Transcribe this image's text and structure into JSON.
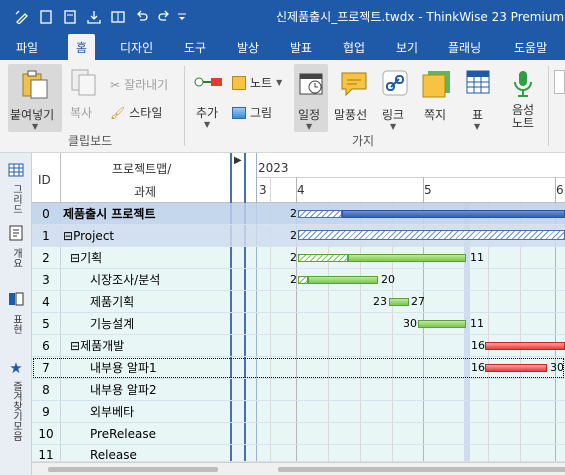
{
  "window": {
    "title": "신제품출시_프로젝트.twdx  -  ThinkWise 23 Premium",
    "brand_color": "#1e5aa8"
  },
  "quick_access": [
    "pen-icon",
    "new-doc-icon",
    "open-doc-icon",
    "save-icon",
    "book-icon",
    "undo-icon",
    "redo-icon",
    "customize-icon"
  ],
  "menus": [
    {
      "label": "파일",
      "active": false
    },
    {
      "label": "홈",
      "active": true
    },
    {
      "label": "디자인",
      "active": false
    },
    {
      "label": "도구",
      "active": false
    },
    {
      "label": "발상",
      "active": false
    },
    {
      "label": "발표",
      "active": false
    },
    {
      "label": "협업",
      "active": false
    },
    {
      "label": "보기",
      "active": false
    },
    {
      "label": "플래닝",
      "active": false
    },
    {
      "label": "도움말",
      "active": false
    }
  ],
  "ribbon": {
    "clipboard": {
      "paste": "붙여넣기",
      "copy": "복사",
      "cut": "잘라내기",
      "style": "스타일",
      "group": "클립보드"
    },
    "branch": {
      "add": "추가",
      "note": "노트",
      "picture": "그림",
      "schedule": "일정",
      "callout": "말풍선",
      "link": "링크",
      "memo": "쪽지",
      "table": "표",
      "voice_note": "음성 노트",
      "group": "가지"
    }
  },
  "side_panel": [
    {
      "icon": "grid-view-icon",
      "label": "그리드"
    },
    {
      "icon": "document-icon",
      "label": "개요"
    },
    {
      "icon": "outline-icon",
      "label": "표현"
    },
    {
      "icon": "star-icon",
      "label": "즐겨찾기모음"
    }
  ],
  "gantt": {
    "headers": {
      "id": "ID",
      "task_line1": "프로젝트맵/",
      "task_line2": "과제",
      "year": "2023"
    },
    "months": [
      "3",
      "4",
      "5",
      "6"
    ],
    "rows": [
      {
        "id": "0",
        "task": "제품출시 프로젝트",
        "indent": 0,
        "toggle": "",
        "bold": true,
        "start_label": "2",
        "end_label": ""
      },
      {
        "id": "1",
        "task": "Project",
        "indent": 0,
        "toggle": "⊟",
        "bold": false,
        "start_label": "2",
        "end_label": ""
      },
      {
        "id": "2",
        "task": "기획",
        "indent": 1,
        "toggle": "⊟",
        "bold": false,
        "start_label": "2",
        "end_label": "11"
      },
      {
        "id": "3",
        "task": "시장조사/분석",
        "indent": 2,
        "toggle": "",
        "bold": false,
        "start_label": "2",
        "end_label": "20"
      },
      {
        "id": "4",
        "task": "제품기획",
        "indent": 2,
        "toggle": "",
        "bold": false,
        "start_label": "23",
        "end_label": "27"
      },
      {
        "id": "5",
        "task": "기능설계",
        "indent": 2,
        "toggle": "",
        "bold": false,
        "start_label": "30",
        "end_label": "11"
      },
      {
        "id": "6",
        "task": "제품개발",
        "indent": 1,
        "toggle": "⊟",
        "bold": false,
        "start_label": "16",
        "end_label": ""
      },
      {
        "id": "7",
        "task": "내부용 알파1",
        "indent": 2,
        "toggle": "",
        "bold": false,
        "start_label": "16",
        "end_label": "30"
      },
      {
        "id": "8",
        "task": "내부용 알파2",
        "indent": 2,
        "toggle": "",
        "bold": false,
        "start_label": "",
        "end_label": ""
      },
      {
        "id": "9",
        "task": "외부베타",
        "indent": 2,
        "toggle": "",
        "bold": false,
        "start_label": "",
        "end_label": ""
      },
      {
        "id": "10",
        "task": "PreRelease",
        "indent": 2,
        "toggle": "",
        "bold": false,
        "start_label": "",
        "end_label": ""
      },
      {
        "id": "11",
        "task": "Release",
        "indent": 2,
        "toggle": "",
        "bold": false,
        "start_label": "",
        "end_label": ""
      }
    ]
  }
}
